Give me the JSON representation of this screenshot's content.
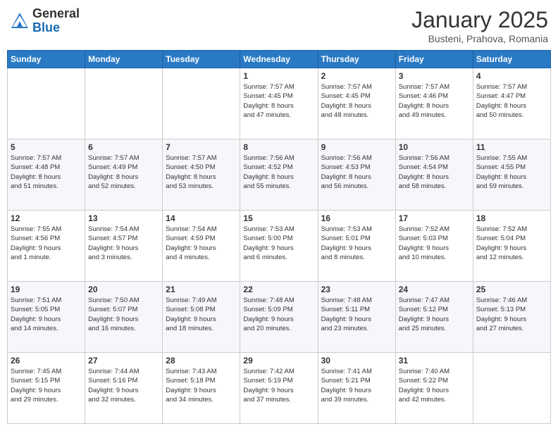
{
  "logo": {
    "general": "General",
    "blue": "Blue"
  },
  "header": {
    "month": "January 2025",
    "location": "Busteni, Prahova, Romania"
  },
  "weekdays": [
    "Sunday",
    "Monday",
    "Tuesday",
    "Wednesday",
    "Thursday",
    "Friday",
    "Saturday"
  ],
  "weeks": [
    [
      {
        "day": "",
        "info": ""
      },
      {
        "day": "",
        "info": ""
      },
      {
        "day": "",
        "info": ""
      },
      {
        "day": "1",
        "info": "Sunrise: 7:57 AM\nSunset: 4:45 PM\nDaylight: 8 hours\nand 47 minutes."
      },
      {
        "day": "2",
        "info": "Sunrise: 7:57 AM\nSunset: 4:45 PM\nDaylight: 8 hours\nand 48 minutes."
      },
      {
        "day": "3",
        "info": "Sunrise: 7:57 AM\nSunset: 4:46 PM\nDaylight: 8 hours\nand 49 minutes."
      },
      {
        "day": "4",
        "info": "Sunrise: 7:57 AM\nSunset: 4:47 PM\nDaylight: 8 hours\nand 50 minutes."
      }
    ],
    [
      {
        "day": "5",
        "info": "Sunrise: 7:57 AM\nSunset: 4:48 PM\nDaylight: 8 hours\nand 51 minutes."
      },
      {
        "day": "6",
        "info": "Sunrise: 7:57 AM\nSunset: 4:49 PM\nDaylight: 8 hours\nand 52 minutes."
      },
      {
        "day": "7",
        "info": "Sunrise: 7:57 AM\nSunset: 4:50 PM\nDaylight: 8 hours\nand 53 minutes."
      },
      {
        "day": "8",
        "info": "Sunrise: 7:56 AM\nSunset: 4:52 PM\nDaylight: 8 hours\nand 55 minutes."
      },
      {
        "day": "9",
        "info": "Sunrise: 7:56 AM\nSunset: 4:53 PM\nDaylight: 8 hours\nand 56 minutes."
      },
      {
        "day": "10",
        "info": "Sunrise: 7:56 AM\nSunset: 4:54 PM\nDaylight: 8 hours\nand 58 minutes."
      },
      {
        "day": "11",
        "info": "Sunrise: 7:55 AM\nSunset: 4:55 PM\nDaylight: 8 hours\nand 59 minutes."
      }
    ],
    [
      {
        "day": "12",
        "info": "Sunrise: 7:55 AM\nSunset: 4:56 PM\nDaylight: 9 hours\nand 1 minute."
      },
      {
        "day": "13",
        "info": "Sunrise: 7:54 AM\nSunset: 4:57 PM\nDaylight: 9 hours\nand 3 minutes."
      },
      {
        "day": "14",
        "info": "Sunrise: 7:54 AM\nSunset: 4:59 PM\nDaylight: 9 hours\nand 4 minutes."
      },
      {
        "day": "15",
        "info": "Sunrise: 7:53 AM\nSunset: 5:00 PM\nDaylight: 9 hours\nand 6 minutes."
      },
      {
        "day": "16",
        "info": "Sunrise: 7:53 AM\nSunset: 5:01 PM\nDaylight: 9 hours\nand 8 minutes."
      },
      {
        "day": "17",
        "info": "Sunrise: 7:52 AM\nSunset: 5:03 PM\nDaylight: 9 hours\nand 10 minutes."
      },
      {
        "day": "18",
        "info": "Sunrise: 7:52 AM\nSunset: 5:04 PM\nDaylight: 9 hours\nand 12 minutes."
      }
    ],
    [
      {
        "day": "19",
        "info": "Sunrise: 7:51 AM\nSunset: 5:05 PM\nDaylight: 9 hours\nand 14 minutes."
      },
      {
        "day": "20",
        "info": "Sunrise: 7:50 AM\nSunset: 5:07 PM\nDaylight: 9 hours\nand 16 minutes."
      },
      {
        "day": "21",
        "info": "Sunrise: 7:49 AM\nSunset: 5:08 PM\nDaylight: 9 hours\nand 18 minutes."
      },
      {
        "day": "22",
        "info": "Sunrise: 7:48 AM\nSunset: 5:09 PM\nDaylight: 9 hours\nand 20 minutes."
      },
      {
        "day": "23",
        "info": "Sunrise: 7:48 AM\nSunset: 5:11 PM\nDaylight: 9 hours\nand 23 minutes."
      },
      {
        "day": "24",
        "info": "Sunrise: 7:47 AM\nSunset: 5:12 PM\nDaylight: 9 hours\nand 25 minutes."
      },
      {
        "day": "25",
        "info": "Sunrise: 7:46 AM\nSunset: 5:13 PM\nDaylight: 9 hours\nand 27 minutes."
      }
    ],
    [
      {
        "day": "26",
        "info": "Sunrise: 7:45 AM\nSunset: 5:15 PM\nDaylight: 9 hours\nand 29 minutes."
      },
      {
        "day": "27",
        "info": "Sunrise: 7:44 AM\nSunset: 5:16 PM\nDaylight: 9 hours\nand 32 minutes."
      },
      {
        "day": "28",
        "info": "Sunrise: 7:43 AM\nSunset: 5:18 PM\nDaylight: 9 hours\nand 34 minutes."
      },
      {
        "day": "29",
        "info": "Sunrise: 7:42 AM\nSunset: 5:19 PM\nDaylight: 9 hours\nand 37 minutes."
      },
      {
        "day": "30",
        "info": "Sunrise: 7:41 AM\nSunset: 5:21 PM\nDaylight: 9 hours\nand 39 minutes."
      },
      {
        "day": "31",
        "info": "Sunrise: 7:40 AM\nSunset: 5:22 PM\nDaylight: 9 hours\nand 42 minutes."
      },
      {
        "day": "",
        "info": ""
      }
    ]
  ]
}
